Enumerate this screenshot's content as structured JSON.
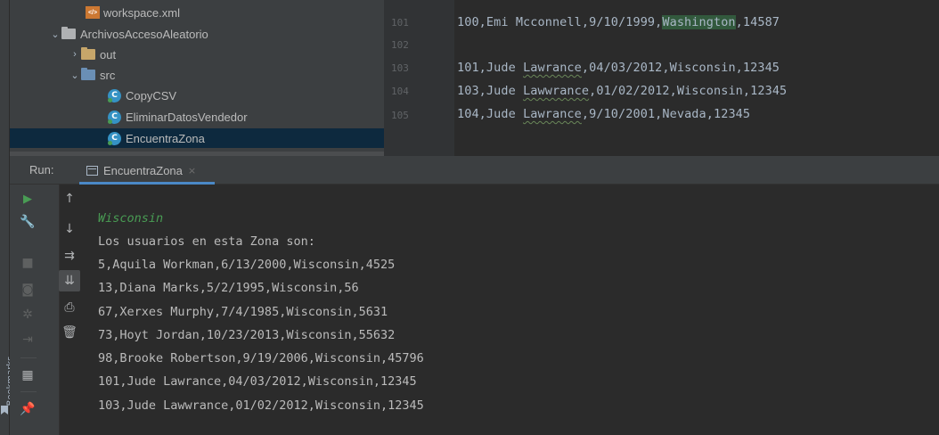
{
  "sidebar": {
    "bookmarks_label": "Bookmarks"
  },
  "tree": {
    "workspace_file": "workspace.xml",
    "xml_badge": "</>",
    "project_folder": "ArchivosAccesoAleatorio",
    "out_folder": "out",
    "src_folder": "src",
    "class_badge": "C",
    "classes": [
      "CopyCSV",
      "EliminarDatosVendedor",
      "EncuentraZona"
    ],
    "selected": "EncuentraZona"
  },
  "editor": {
    "line_numbers": [
      "101",
      "102",
      "103",
      "104",
      "105"
    ],
    "line_101_pre": "100,Emi Mcconnell,9/10/1999,",
    "line_101_hl": "Washington",
    "line_101_post": ",14587",
    "line_103_pre": "101,Jude ",
    "line_103_typo": "Lawrance",
    "line_103_post": ",04/03/2012,Wisconsin,12345",
    "line_104_pre": "103,Jude ",
    "line_104_typo": "Lawwrance",
    "line_104_post": ",01/02/2012,Wisconsin,12345",
    "line_105_pre": "104,Jude ",
    "line_105_typo": "Lawrance",
    "line_105_post": ",9/10/2001,Nevada,12345"
  },
  "run": {
    "title": "Run:",
    "tab_label": "EncuentraZona",
    "tab_close": "×"
  },
  "console": {
    "input_echo": "Wisconsin",
    "header": "Los usuarios en esta Zona son:",
    "lines": [
      "5,Aquila Workman,6/13/2000,Wisconsin,4525",
      "13,Diana Marks,5/2/1995,Wisconsin,56",
      "67,Xerxes Murphy,7/4/1985,Wisconsin,5631",
      "73,Hoyt Jordan,10/23/2013,Wisconsin,55632",
      "98,Brooke Robertson,9/19/2006,Wisconsin,45796",
      "101,Jude Lawrance,04/03/2012,Wisconsin,12345",
      "103,Jude Lawwrance,01/02/2012,Wisconsin,12345"
    ]
  },
  "icons": {
    "chevron_down": "⌄",
    "chevron_right": "›",
    "run": "▶",
    "wrench": "🔧",
    "stop": "■",
    "camera": "◙",
    "bug": "✲",
    "exit": "⇥",
    "layout": "▦",
    "pin": "📌",
    "up": "↑",
    "down": "↓",
    "soft_wrap": "⇉",
    "scroll_end": "⇊",
    "print": "⎙",
    "trash": "🗑"
  },
  "colors": {
    "accent": "#4a88c7",
    "run_green": "#499c54",
    "highlight": "#32593d",
    "selection": "#0d293e"
  }
}
